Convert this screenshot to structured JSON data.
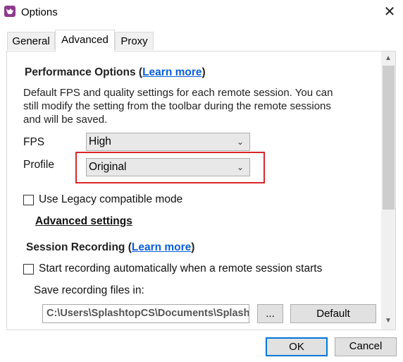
{
  "window": {
    "title": "Options",
    "close_glyph": "✕"
  },
  "tabs": [
    {
      "label": "General",
      "active": false
    },
    {
      "label": "Advanced",
      "active": true
    },
    {
      "label": "Proxy",
      "active": false
    }
  ],
  "performance": {
    "heading": "Performance Options (",
    "heading_link": "Learn more",
    "heading_close": ")",
    "description": [
      "Default FPS and quality settings for each remote session. You can",
      "still modify the setting from the toolbar during the remote sessions",
      "and will be saved."
    ],
    "fps_label": "FPS",
    "fps_value": "High",
    "profile_label": "Profile",
    "profile_value": "Original",
    "legacy_label": "Use Legacy compatible mode",
    "legacy_checked": false,
    "advanced_link": "Advanced settings"
  },
  "recording": {
    "heading": "Session Recording (",
    "heading_link": "Learn more",
    "heading_close": ")",
    "auto_label": "Start recording automatically when a remote session starts",
    "auto_checked": false,
    "save_label": "Save recording files in:",
    "path_value": "C:\\Users\\SplashtopCS\\Documents\\Splash",
    "browse_label": "...",
    "default_label": "Default"
  },
  "footer": {
    "ok_label": "OK",
    "cancel_label": "Cancel"
  },
  "colors": {
    "accent": "#0078d7",
    "highlight": "#d8262a",
    "link": "#0a5fd8",
    "app_icon": "#8c3a8c"
  },
  "icons": {
    "app": "splashtop-app-icon",
    "close": "close-icon",
    "chevron": "chevron-down-icon",
    "checkbox": "checkbox-icon"
  }
}
